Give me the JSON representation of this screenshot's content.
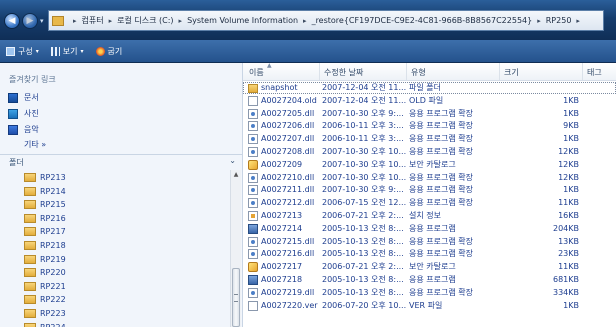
{
  "address": {
    "back_glyph": "◀",
    "forward_glyph": "▶",
    "dropdown_glyph": "▾",
    "separator": "▸",
    "crumbs": [
      "컴퓨터",
      "로컬 디스크 (C:)",
      "System Volume Information",
      "_restore{CF197DCE-C9E2-4C81-966B-8B8567C22554}",
      "RP250"
    ]
  },
  "toolbar": {
    "organize": "구성",
    "view": "보기",
    "burn": "굽기",
    "arrow": "▾"
  },
  "favorites": {
    "title": "즐겨찾기 링크",
    "items": [
      {
        "label": "문서",
        "icon": "documents-icon"
      },
      {
        "label": "사진",
        "icon": "pictures-icon"
      },
      {
        "label": "음악",
        "icon": "music-icon"
      }
    ],
    "more": "기타 »"
  },
  "folders": {
    "header": "폴더",
    "chevron": "⌄",
    "items": [
      "RP213",
      "RP214",
      "RP215",
      "RP216",
      "RP217",
      "RP218",
      "RP219",
      "RP220",
      "RP221",
      "RP222",
      "RP223",
      "RP224"
    ]
  },
  "columns": {
    "name": "이름",
    "date": "수정한 날짜",
    "type": "유형",
    "size": "크기",
    "tags": "태그"
  },
  "files": [
    {
      "name": "snapshot",
      "date": "2007-12-04 오전 11...",
      "type": "파일 폴더",
      "size": "",
      "icon": "folder"
    },
    {
      "name": "A0027204.old",
      "date": "2007-12-04 오전 11...",
      "type": "OLD 파일",
      "size": "1KB",
      "icon": "doc"
    },
    {
      "name": "A0027205.dll",
      "date": "2007-10-30 오후 9:...",
      "type": "응용 프로그램 확장",
      "size": "1KB",
      "icon": "dll"
    },
    {
      "name": "A0027206.dll",
      "date": "2006-10-11 오후 3:...",
      "type": "응용 프로그램 확장",
      "size": "9KB",
      "icon": "dll"
    },
    {
      "name": "A0027207.dll",
      "date": "2006-10-11 오후 3:...",
      "type": "응용 프로그램 확장",
      "size": "1KB",
      "icon": "dll"
    },
    {
      "name": "A0027208.dll",
      "date": "2007-10-30 오후 10...",
      "type": "응용 프로그램 확장",
      "size": "12KB",
      "icon": "dll"
    },
    {
      "name": "A0027209",
      "date": "2007-10-30 오후 10...",
      "type": "보안 카탈로그",
      "size": "12KB",
      "icon": "cat"
    },
    {
      "name": "A0027210.dll",
      "date": "2007-10-30 오후 10...",
      "type": "응용 프로그램 확장",
      "size": "12KB",
      "icon": "dll"
    },
    {
      "name": "A0027211.dll",
      "date": "2007-10-30 오후 9:...",
      "type": "응용 프로그램 확장",
      "size": "1KB",
      "icon": "dll"
    },
    {
      "name": "A0027212.dll",
      "date": "2006-07-15 오전 12...",
      "type": "응용 프로그램 확장",
      "size": "11KB",
      "icon": "dll"
    },
    {
      "name": "A0027213",
      "date": "2006-07-21 오후 2:...",
      "type": "설치 정보",
      "size": "16KB",
      "icon": "inf"
    },
    {
      "name": "A0027214",
      "date": "2005-10-13 오전 8:...",
      "type": "응용 프로그램",
      "size": "204KB",
      "icon": "exe"
    },
    {
      "name": "A0027215.dll",
      "date": "2005-10-13 오전 8:...",
      "type": "응용 프로그램 확장",
      "size": "13KB",
      "icon": "dll"
    },
    {
      "name": "A0027216.dll",
      "date": "2005-10-13 오전 8:...",
      "type": "응용 프로그램 확장",
      "size": "23KB",
      "icon": "dll"
    },
    {
      "name": "A0027217",
      "date": "2006-07-21 오후 2:...",
      "type": "보안 카탈로그",
      "size": "11KB",
      "icon": "cat"
    },
    {
      "name": "A0027218",
      "date": "2005-10-13 오전 8:...",
      "type": "응용 프로그램",
      "size": "681KB",
      "icon": "exe"
    },
    {
      "name": "A0027219.dll",
      "date": "2005-10-13 오전 8:...",
      "type": "응용 프로그램 확장",
      "size": "334KB",
      "icon": "dll"
    },
    {
      "name": "A0027220.ver",
      "date": "2006-07-20 오후 10...",
      "type": "VER 파일",
      "size": "1KB",
      "icon": "doc"
    }
  ]
}
